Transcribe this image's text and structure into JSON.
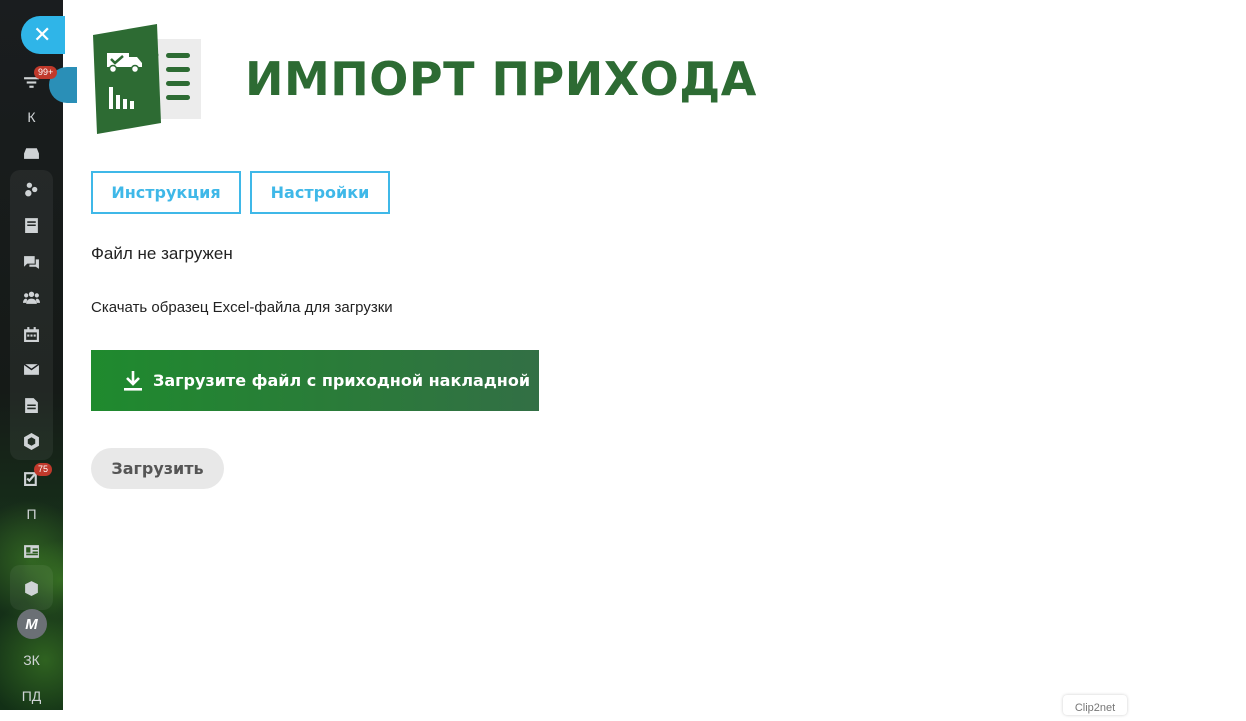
{
  "sidebar": {
    "close_icon": "close-icon",
    "items": [
      {
        "icon": "filter-icon",
        "badge": "99+"
      },
      {
        "label": "К"
      },
      {
        "icon": "inbox-tray-icon"
      },
      {
        "icon": "crm-circles-icon"
      },
      {
        "icon": "note-icon"
      },
      {
        "icon": "chat-icon"
      },
      {
        "icon": "people-icon"
      },
      {
        "icon": "calendar-icon"
      },
      {
        "icon": "mail-icon"
      },
      {
        "icon": "document-icon"
      },
      {
        "icon": "hexagon-icon"
      },
      {
        "icon": "tasks-checkbox-icon",
        "badge": "75"
      },
      {
        "label": "П"
      },
      {
        "icon": "contact-card-icon"
      },
      {
        "icon": "box-icon"
      },
      {
        "icon": "m-logo-icon",
        "label": "M"
      },
      {
        "label": "ЗК"
      },
      {
        "label": "ПД"
      }
    ]
  },
  "header": {
    "title": "ИМПОРТ ПРИХОДА",
    "logo_icon": "excel-truck-logo-icon"
  },
  "tabs": {
    "instruction": "Инструкция",
    "settings": "Настройки"
  },
  "status": "Файл не загружен",
  "sample_link": "Скачать образец Excel-файла для загрузки",
  "upload_file_button": "Загрузите файл с приходной накладной",
  "submit_button": "Загрузить",
  "footer_badge": "Clip2net",
  "colors": {
    "accent_blue": "#3fb8e8",
    "title_green": "#2d6b33",
    "upload_green": "#1f8a2e"
  }
}
